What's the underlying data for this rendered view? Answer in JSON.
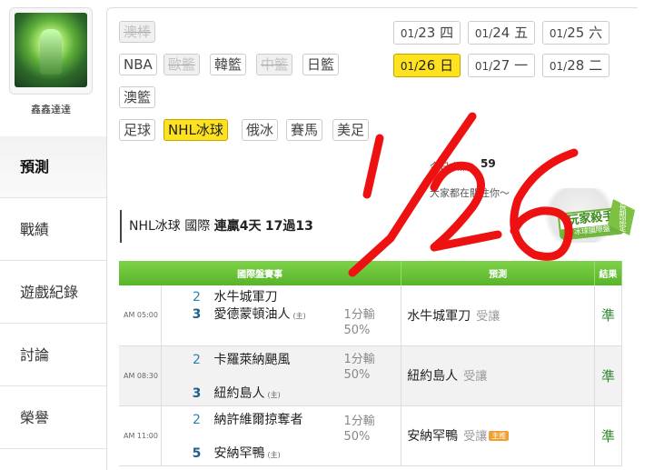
{
  "profile": {
    "username": "鑫鑫達達"
  },
  "nav": [
    {
      "label": "預測",
      "active": true
    },
    {
      "label": "戰績"
    },
    {
      "label": "遊戲紀錄"
    },
    {
      "label": "討論"
    },
    {
      "label": "榮譽"
    }
  ],
  "sports": [
    {
      "label": "澳棒",
      "state": "disabled"
    },
    {
      "label": "NBA",
      "state": "normal"
    },
    {
      "label": "歐籃",
      "state": "disabled"
    },
    {
      "label": "韓籃",
      "state": "normal"
    },
    {
      "label": "中籃",
      "state": "disabled"
    },
    {
      "label": "日籃",
      "state": "normal"
    },
    {
      "label": "澳籃",
      "state": "normal"
    },
    {
      "label": "足球",
      "state": "normal"
    },
    {
      "label": "NHL冰球",
      "state": "selected"
    },
    {
      "label": "俄冰",
      "state": "normal"
    },
    {
      "label": "賽馬",
      "state": "normal"
    },
    {
      "label": "美足",
      "state": "normal"
    }
  ],
  "dates": [
    {
      "md": "01/",
      "day": "23",
      "wd": "四"
    },
    {
      "md": "01/",
      "day": "24",
      "wd": "五"
    },
    {
      "md": "01/",
      "day": "25",
      "wd": "六"
    },
    {
      "md": "01/",
      "day": "26",
      "wd": "日",
      "selected": true
    },
    {
      "md": "01/",
      "day": "27",
      "wd": "一"
    },
    {
      "md": "01/",
      "day": "28",
      "wd": "二"
    }
  ],
  "popularity": {
    "label": "今日人氣",
    "value": "59",
    "note": "大家都在關注你～"
  },
  "badge": {
    "title": "玩家殺手",
    "subtitle": "冰球國際盤",
    "tag": "長期認定"
  },
  "summary": {
    "league": "NHL冰球",
    "market": "國際",
    "streak": "連贏4天",
    "record": "17過13"
  },
  "table": {
    "headers": [
      "國際盤賽事",
      "預測",
      "結果"
    ],
    "rows": [
      {
        "time": "AM 05:00",
        "away_score": "2",
        "away": "水牛城軍刀",
        "home_score": "3",
        "home": "愛德蒙頓油人",
        "home_mark": "(主)",
        "spread": "1分輸",
        "pct": "50%",
        "pick": "水牛城軍刀",
        "pick_type": "受讓",
        "chip": "",
        "result": "準"
      },
      {
        "time": "AM 08:30",
        "away_score": "2",
        "away": "卡羅萊納颶風",
        "home_score": "3",
        "home": "紐約島人",
        "home_mark": "(主)",
        "spread": "1分輸",
        "pct": "50%",
        "pick": "紐約島人",
        "pick_type": "受讓",
        "chip": "",
        "result": "準"
      },
      {
        "time": "AM 11:00",
        "away_score": "2",
        "away": "納許維爾掠奪者",
        "home_score": "5",
        "home": "安納罕鴨",
        "home_mark": "(主)",
        "spread": "1分輸",
        "pct": "50%",
        "pick": "安納罕鴨",
        "pick_type": "受讓",
        "chip": "主推",
        "result": "準"
      }
    ]
  },
  "annotation": {
    "handwriting": "1/26",
    "color": "#ee1111"
  }
}
